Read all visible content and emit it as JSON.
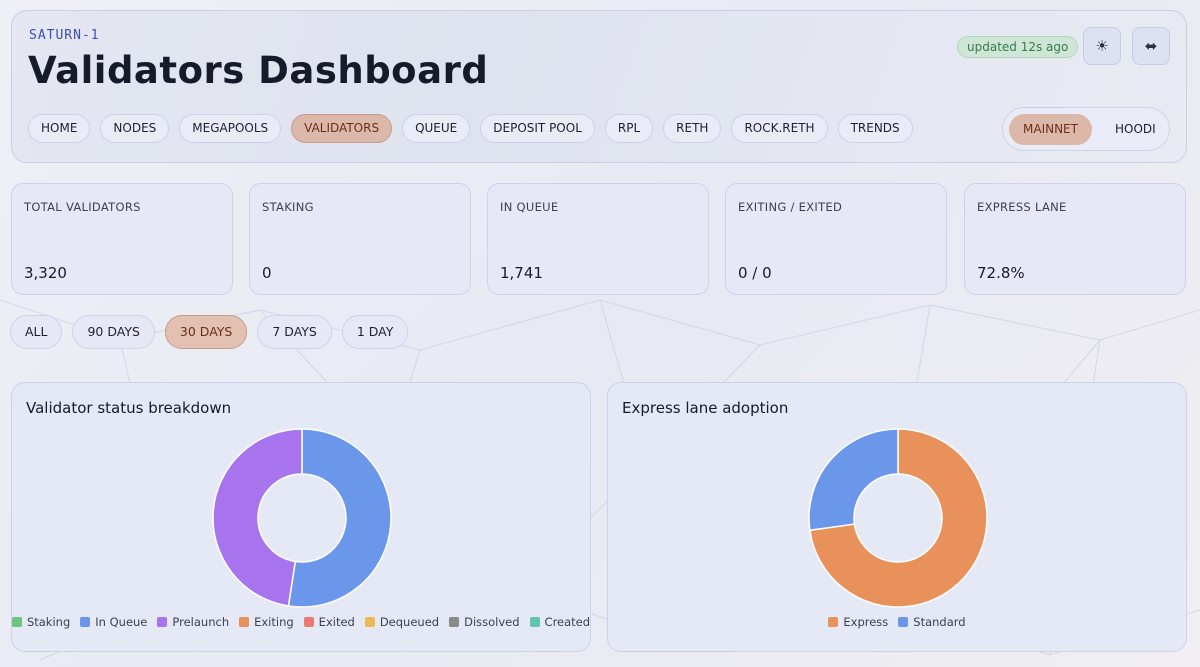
{
  "header": {
    "brand": "SATURN-1",
    "title": "Validators Dashboard",
    "updated": "updated 12s ago",
    "theme_icon": "sun-icon",
    "swap_icon": "arrows-horizontal-icon"
  },
  "nav": [
    {
      "label": "HOME"
    },
    {
      "label": "NODES"
    },
    {
      "label": "MEGAPOOLS"
    },
    {
      "label": "VALIDATORS",
      "active": true
    },
    {
      "label": "QUEUE"
    },
    {
      "label": "DEPOSIT POOL"
    },
    {
      "label": "RPL"
    },
    {
      "label": "RETH"
    },
    {
      "label": "ROCK.RETH"
    },
    {
      "label": "TRENDS"
    }
  ],
  "network": {
    "options": [
      "MAINNET",
      "HOODI"
    ],
    "selected": "MAINNET"
  },
  "stats": [
    {
      "label": "TOTAL VALIDATORS",
      "value": "3,320"
    },
    {
      "label": "STAKING",
      "value": "0"
    },
    {
      "label": "IN QUEUE",
      "value": "1,741"
    },
    {
      "label": "EXITING / EXITED",
      "value": "0 / 0"
    },
    {
      "label": "EXPRESS LANE",
      "value": "72.8%"
    }
  ],
  "ranges": {
    "options": [
      "ALL",
      "90 DAYS",
      "30 DAYS",
      "7 DAYS",
      "1 DAY"
    ],
    "selected": "30 DAYS"
  },
  "colors": {
    "active_bg": "#dcb8ab",
    "staking": "#6cc47f",
    "in_queue": "#6b97ea",
    "prelaunch": "#a874ee",
    "exiting": "#e8915a",
    "exited": "#ec7a72",
    "dequeued": "#e8bb55",
    "dissolved": "#8a8a8a",
    "created": "#62c4ad",
    "express": "#e8915a",
    "standard": "#6b97ea"
  },
  "chart_data": [
    {
      "type": "pie",
      "title": "Validator status breakdown",
      "donut": true,
      "legend_position": "bottom",
      "categories": [
        "Staking",
        "In Queue",
        "Prelaunch",
        "Exiting",
        "Exited",
        "Dequeued",
        "Dissolved",
        "Created"
      ],
      "values": [
        0,
        1741,
        1579,
        0,
        0,
        0,
        0,
        0
      ],
      "colors": [
        "#6cc47f",
        "#6b97ea",
        "#a874ee",
        "#e8915a",
        "#ec7a72",
        "#e8bb55",
        "#8a8a8a",
        "#62c4ad"
      ]
    },
    {
      "type": "pie",
      "title": "Express lane adoption",
      "donut": true,
      "legend_position": "bottom",
      "categories": [
        "Express",
        "Standard"
      ],
      "values": [
        72.8,
        27.2
      ],
      "colors": [
        "#e8915a",
        "#6b97ea"
      ]
    }
  ]
}
